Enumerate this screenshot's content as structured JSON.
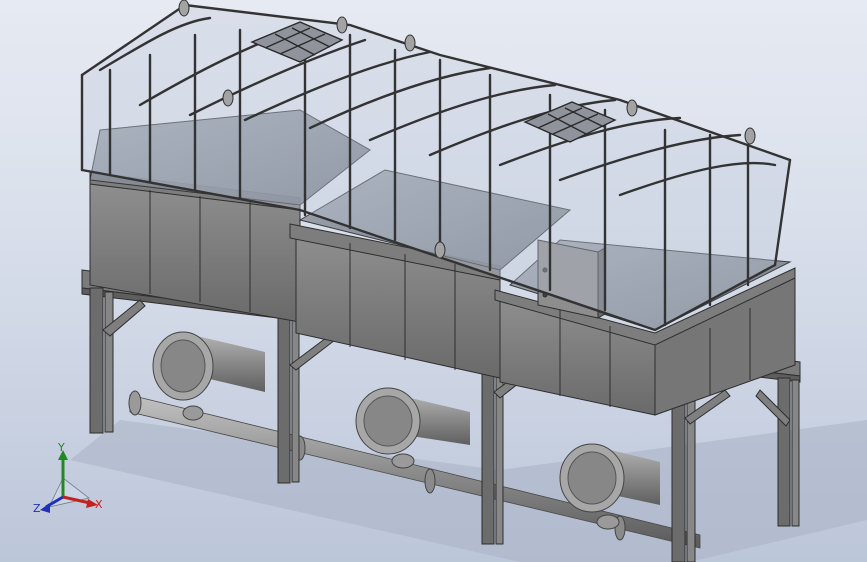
{
  "view": {
    "background": {
      "top": "#e6eaf2",
      "bottom": "#bcc6d9"
    },
    "model_colors": {
      "steel": "#8e8e8e",
      "steel_dark": "#5e5e5e",
      "steel_light": "#b4b4b4",
      "glass_fill": "#c3ccdd",
      "frame_dark": "#2e2e2e"
    }
  },
  "triad": {
    "y_label": "Y",
    "x_label": "X",
    "z_label": "Z",
    "y_color": "#1f8a1f",
    "x_color": "#c32020",
    "z_color": "#2030b8"
  }
}
